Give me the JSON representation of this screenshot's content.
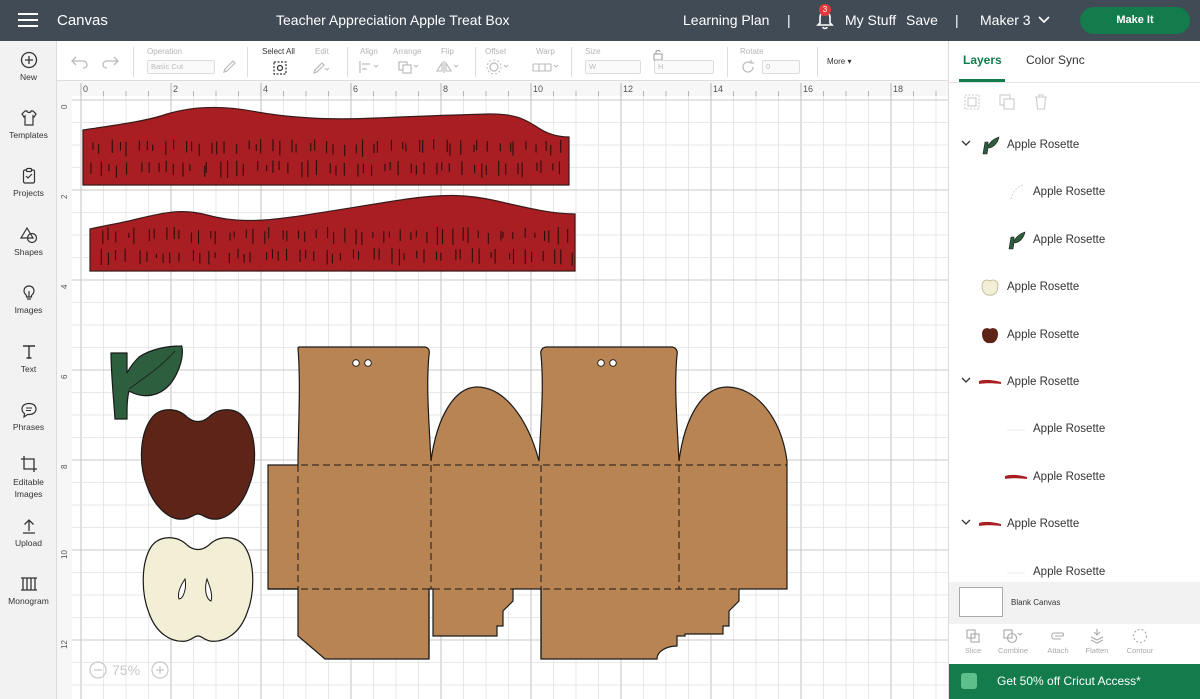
{
  "topbar": {
    "menu_icon": "hamburger-icon",
    "app_name": "Canvas",
    "project_title": "Teacher Appreciation Apple Treat Box",
    "learning_plan": "Learning Plan",
    "separator": "|",
    "notification_count": "3",
    "my_stuff": "My Stuff",
    "save": "Save",
    "machine": "Maker 3",
    "make_it": "Make It"
  },
  "leftbar": {
    "items": [
      {
        "label": "New",
        "icon": "plus-circle-icon"
      },
      {
        "label": "Templates",
        "icon": "shirt-icon"
      },
      {
        "label": "Projects",
        "icon": "clipboard-icon"
      },
      {
        "label": "Shapes",
        "icon": "shapes-icon"
      },
      {
        "label": "Images",
        "icon": "bulb-icon"
      },
      {
        "label": "Text",
        "icon": "text-icon"
      },
      {
        "label": "Phrases",
        "icon": "speech-icon"
      },
      {
        "label": "Editable Images",
        "icon": "crop-icon"
      },
      {
        "label": "Upload",
        "icon": "upload-icon"
      },
      {
        "label": "Monogram",
        "icon": "monogram-icon"
      }
    ]
  },
  "toolbar": {
    "operation_label": "Operation",
    "operation_value": "Basic Cut",
    "select_all": "Select All",
    "edit": "Edit",
    "align": "Align",
    "arrange": "Arrange",
    "flip": "Flip",
    "offset": "Offset",
    "warp": "Warp",
    "size": "Size",
    "size_w": "W",
    "size_h": "H",
    "rotate": "Rotate",
    "rotate_value": "0",
    "more": "More"
  },
  "canvas": {
    "ruler_top": [
      "0",
      "2",
      "4",
      "6",
      "8",
      "10",
      "12",
      "14",
      "16",
      "18"
    ],
    "ruler_left": [
      "0",
      "2",
      "4",
      "6",
      "8",
      "10",
      "12"
    ],
    "zoom": "75%",
    "colors": {
      "red_strip": "#a91e22",
      "leaf": "#2d5e3e",
      "apple_dark": "#5e2418",
      "apple_cream": "#f3efd6",
      "box": "#b98453",
      "grid_line": "#e2e2e2",
      "grid_major": "#c8c8c8"
    }
  },
  "panel": {
    "tab_layers": "Layers",
    "tab_color_sync": "Color Sync",
    "layers": [
      {
        "label": "Apple Rosette",
        "expanded": true,
        "thumb": "leaf",
        "level": 0
      },
      {
        "label": "Apple Rosette",
        "thumb": "dotted",
        "level": 1
      },
      {
        "label": "Apple Rosette",
        "thumb": "leaf",
        "level": 1
      },
      {
        "label": "Apple Rosette",
        "thumb": "apple-cream",
        "level": 0
      },
      {
        "label": "Apple Rosette",
        "thumb": "apple-dark",
        "level": 0
      },
      {
        "label": "Apple Rosette",
        "expanded": true,
        "thumb": "red-strip",
        "level": 0
      },
      {
        "label": "Apple Rosette",
        "thumb": "blank",
        "level": 1
      },
      {
        "label": "Apple Rosette",
        "thumb": "red-strip",
        "level": 1
      },
      {
        "label": "Apple Rosette",
        "expanded": true,
        "thumb": "red-strip",
        "level": 0
      },
      {
        "label": "Apple Rosette",
        "thumb": "blank",
        "level": 1
      }
    ],
    "blank_canvas": "Blank Canvas",
    "tools": [
      "Slice",
      "Combine",
      "Attach",
      "Flatten",
      "Contour"
    ],
    "promo": "Get 50% off Cricut Access*"
  }
}
